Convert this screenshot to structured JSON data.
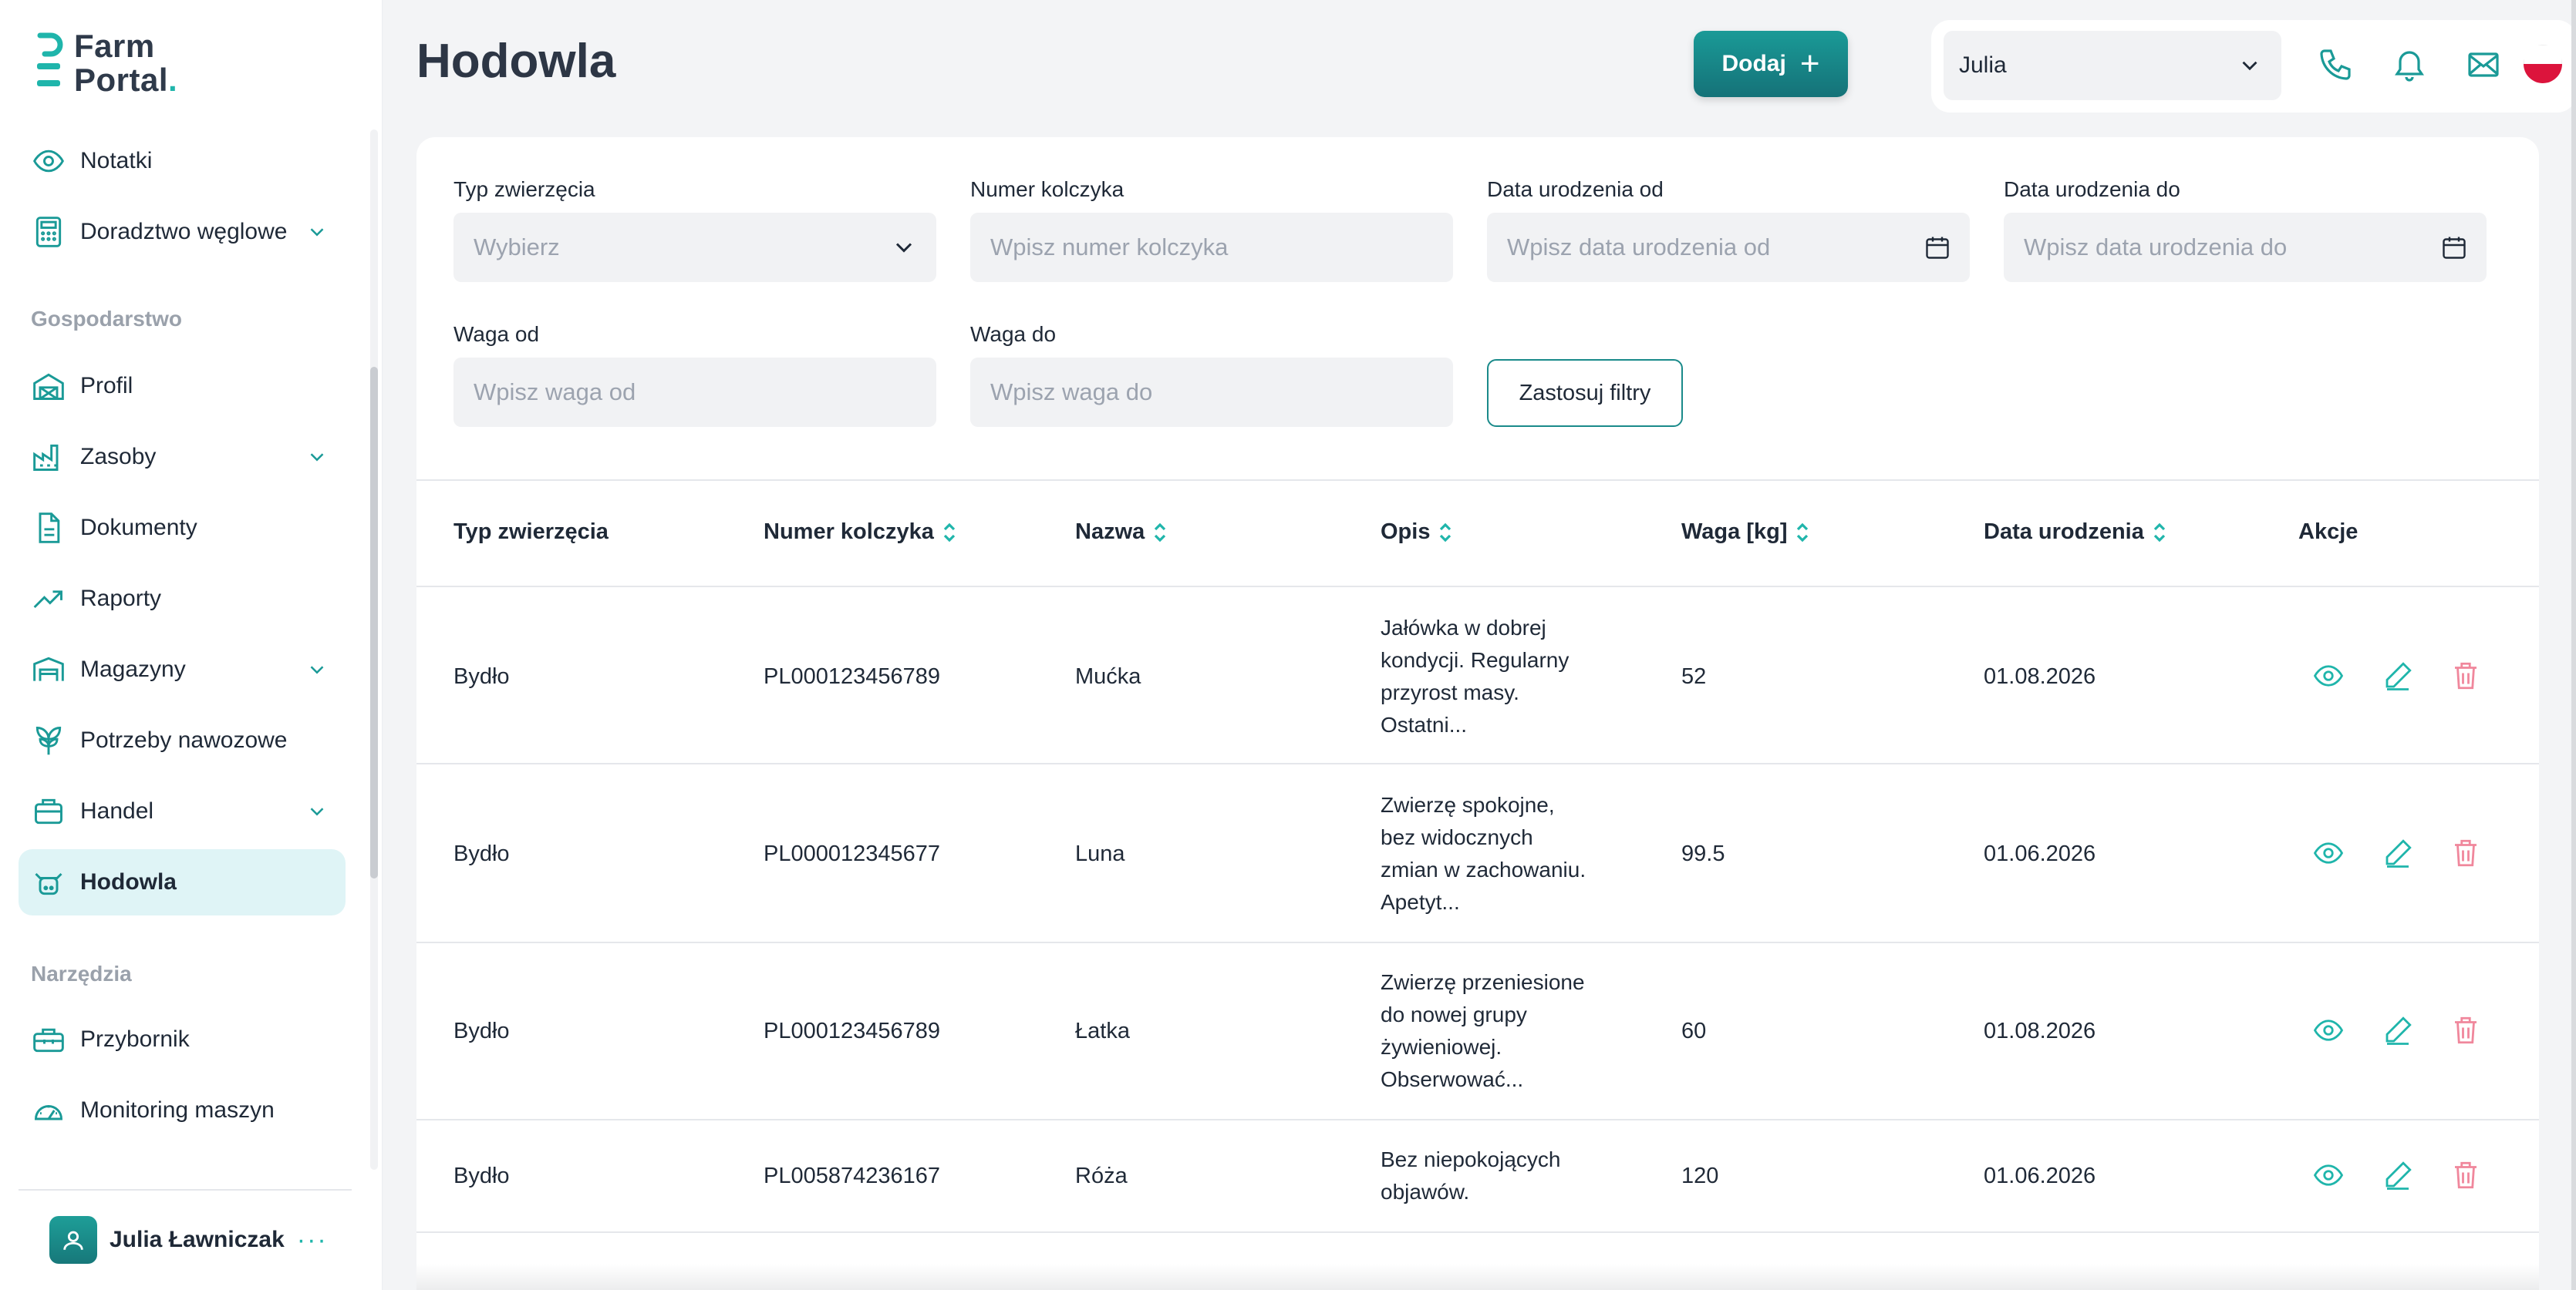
{
  "app": {
    "logo_line1": "Farm",
    "logo_line2": "Portal",
    "logo_dot": ".",
    "brand_color": "#1a9a97"
  },
  "sidebar": {
    "items_top": [
      {
        "label": "Notatki",
        "icon": "eye-icon"
      },
      {
        "label": "Doradztwo węglowe",
        "icon": "calculator-icon",
        "expandable": true
      }
    ],
    "section_farm": "Gospodarstwo",
    "items_farm": [
      {
        "label": "Profil",
        "icon": "barn-icon"
      },
      {
        "label": "Zasoby",
        "icon": "factory-icon",
        "expandable": true
      },
      {
        "label": "Dokumenty",
        "icon": "document-icon"
      },
      {
        "label": "Raporty",
        "icon": "trending-up-icon"
      },
      {
        "label": "Magazyny",
        "icon": "warehouse-icon",
        "expandable": true
      },
      {
        "label": "Potrzeby nawozowe",
        "icon": "leaf-icon"
      },
      {
        "label": "Handel",
        "icon": "briefcase-icon",
        "expandable": true
      },
      {
        "label": "Hodowla",
        "icon": "cow-icon",
        "active": true
      }
    ],
    "section_tools": "Narzędzia",
    "items_tools": [
      {
        "label": "Przybornik",
        "icon": "toolbox-icon"
      },
      {
        "label": "Monitoring maszyn",
        "icon": "gauge-icon"
      }
    ],
    "user": {
      "name": "Julia Ławniczak",
      "more": "···"
    }
  },
  "header": {
    "title": "Hodowla",
    "add_button": "Dodaj",
    "user_select": "Julia"
  },
  "filters": {
    "animal_type": {
      "label": "Typ zwierzęcia",
      "placeholder": "Wybierz"
    },
    "tag_number": {
      "label": "Numer kolczyka",
      "placeholder": "Wpisz numer kolczyka"
    },
    "birth_from": {
      "label": "Data urodzenia od",
      "placeholder": "Wpisz data urodzenia od"
    },
    "birth_to": {
      "label": "Data urodzenia do",
      "placeholder": "Wpisz data urodzenia do"
    },
    "weight_from": {
      "label": "Waga od",
      "placeholder": "Wpisz waga od"
    },
    "weight_to": {
      "label": "Waga do",
      "placeholder": "Wpisz waga do"
    },
    "apply": "Zastosuj filtry"
  },
  "table": {
    "columns": [
      "Typ zwierzęcia",
      "Numer kolczyka",
      "Nazwa",
      "Opis",
      "Waga [kg]",
      "Data urodzenia",
      "Akcje"
    ],
    "rows": [
      {
        "type": "Bydło",
        "tag": "PL000123456789",
        "name": "Mućka",
        "desc": [
          "Jałówka w dobrej",
          "kondycji. Regularny",
          "przyrost masy.",
          "Ostatni..."
        ],
        "weight": "52",
        "birth": "01.08.2026"
      },
      {
        "type": "Bydło",
        "tag": "PL000012345677",
        "name": "Luna",
        "desc": [
          "Zwierzę spokojne,",
          "bez widocznych",
          "zmian w zachowaniu.",
          "Apetyt..."
        ],
        "weight": "99.5",
        "birth": "01.06.2026"
      },
      {
        "type": "Bydło",
        "tag": "PL000123456789",
        "name": "Łatka",
        "desc": [
          "Zwierzę przeniesione",
          "do nowej grupy",
          "żywieniowej.",
          "Obserwować..."
        ],
        "weight": "60",
        "birth": "01.08.2026"
      },
      {
        "type": "Bydło",
        "tag": "PL005874236167",
        "name": "Róża",
        "desc": [
          "Bez niepokojących",
          "objawów."
        ],
        "weight": "120",
        "birth": "01.06.2026"
      }
    ]
  }
}
